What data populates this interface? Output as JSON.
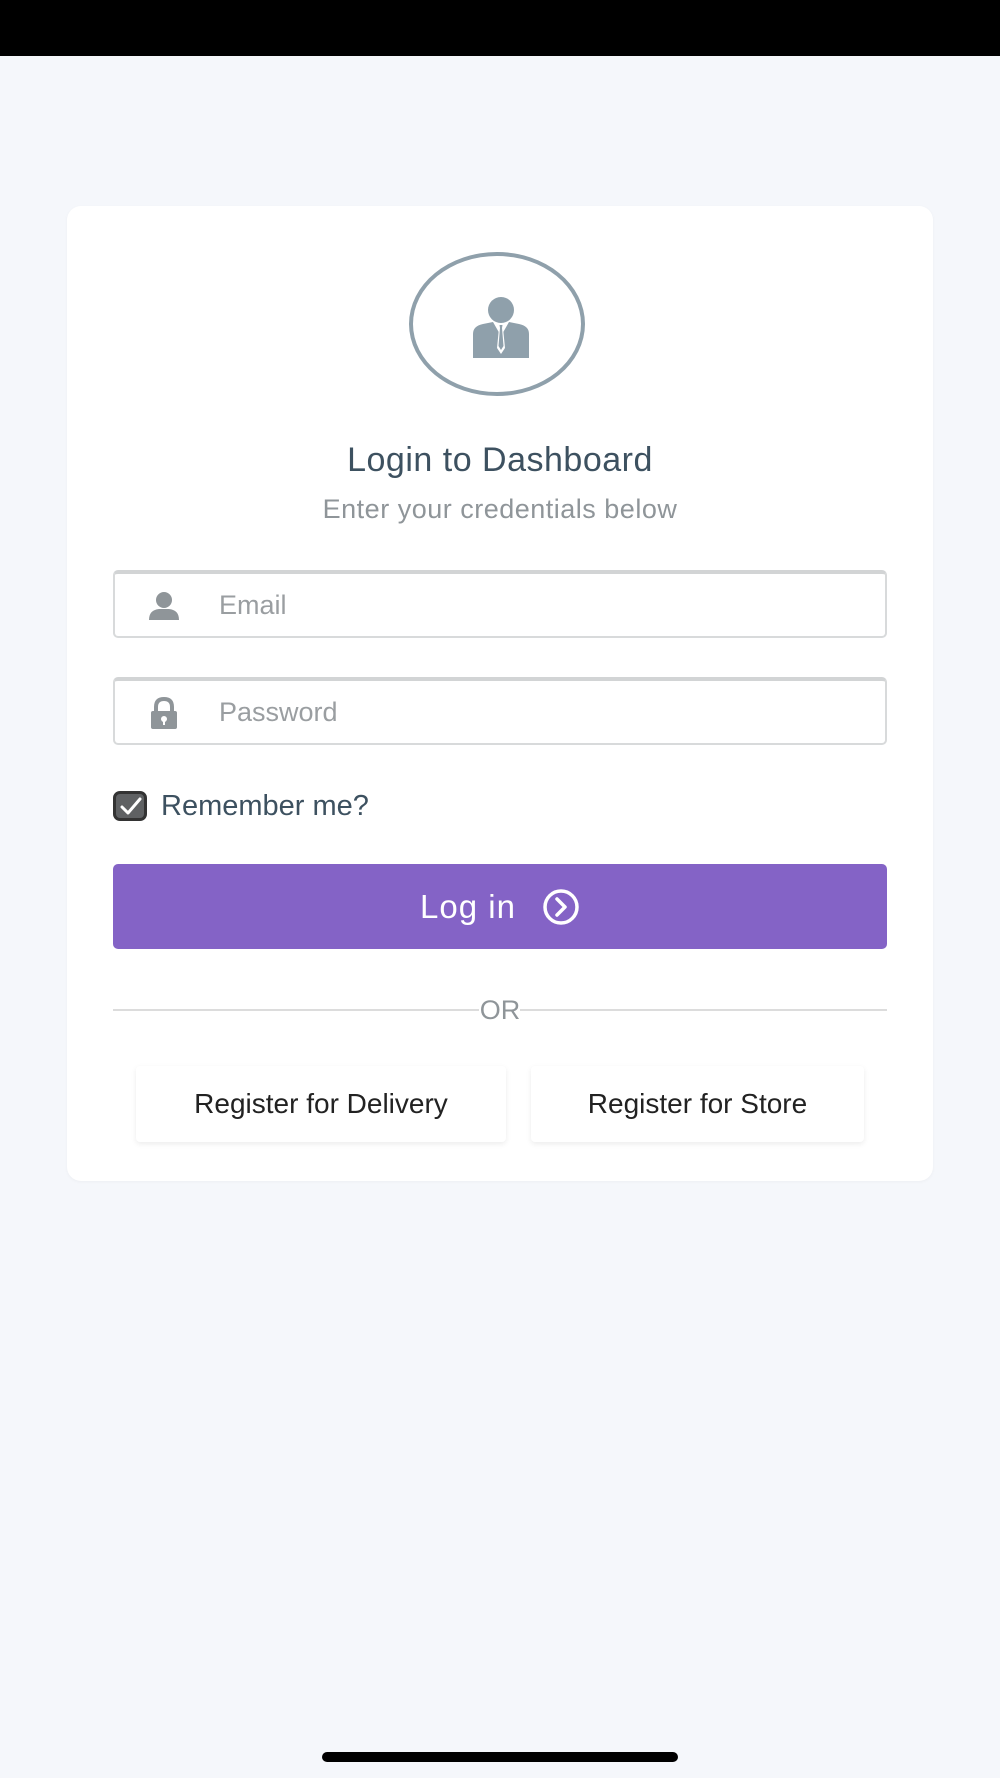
{
  "login": {
    "title": "Login to Dashboard",
    "subtitle": "Enter your credentials below",
    "email_placeholder": "Email",
    "password_placeholder": "Password",
    "email_value": "",
    "password_value": "",
    "remember_label": "Remember me?",
    "remember_checked": true,
    "login_label": "Log in",
    "divider_text": "OR",
    "register_delivery_label": "Register for Delivery",
    "register_store_label": "Register for Store"
  },
  "icons": {
    "avatar": "user-tie-icon",
    "email_field": "user-icon",
    "password_field": "lock-icon",
    "login_button": "arrow-circle-right-icon",
    "checkbox": "check-icon"
  },
  "colors": {
    "page_background": "#f5f7fb",
    "card_background": "#ffffff",
    "accent": "#8463c6",
    "title_text": "#3d5160",
    "muted_text": "#8f9599",
    "avatar_icon": "#8fa0ab",
    "status_bar": "#000000"
  }
}
